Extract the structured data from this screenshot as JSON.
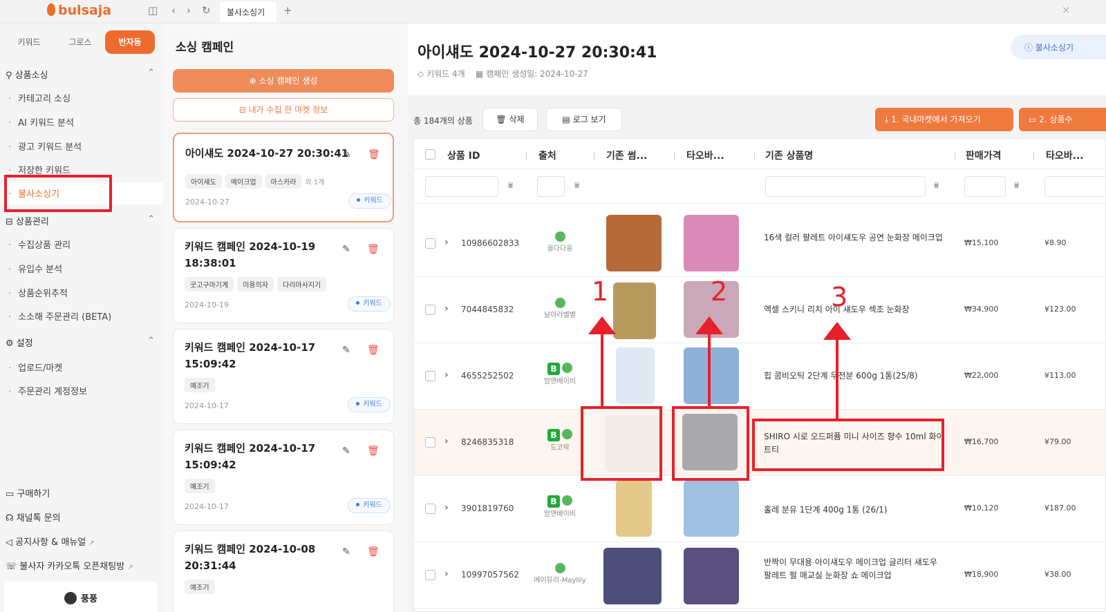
{
  "app": {
    "logo": "bulsaja",
    "tab_title": "불사소싱기"
  },
  "sidebar": {
    "segments": [
      "키워드",
      "그로스",
      "반자동"
    ],
    "active_segment": "반자동",
    "sections": [
      {
        "label": "상품소싱",
        "items": [
          "카테고리 소싱",
          "AI 키워드 분석",
          "광고 키워드 분석",
          "저장한 키워드",
          "불사소싱기"
        ]
      },
      {
        "label": "상품관리",
        "items": [
          "수집상품 관리",
          "유입수 분석",
          "상품순위추적",
          "소소해 주문관리 (BETA)"
        ]
      },
      {
        "label": "설정",
        "items": [
          "업로드/마켓",
          "주문관리 계정정보"
        ]
      }
    ],
    "selected_item": "불사소싱기",
    "bottom": [
      "구매하기",
      "채널톡 문의",
      "공지사항 & 매뉴얼",
      "불사자 카카오톡 오픈채팅방"
    ],
    "user_name": "풍풍"
  },
  "campaigns": {
    "title": "소싱 캠페인",
    "create_button": "소싱 캠페인 생성",
    "info_button": "내가 수집 한 마켓 정보",
    "cards": [
      {
        "title_line1": "아이섀도 2024-10-27 20:30:41",
        "title_line2": "",
        "chips": [
          "아이섀도",
          "메이크업",
          "마스카라"
        ],
        "more": "외 1개",
        "date": "2024-10-27",
        "badge": "키워드",
        "active": true
      },
      {
        "title_line1": "키워드 캠페인 2024-10-19",
        "title_line2": "18:38:01",
        "chips": [
          "굿고구마기계",
          "미용의자",
          "다리마사지기"
        ],
        "more": "",
        "date": "2024-10-19",
        "badge": "키워드"
      },
      {
        "title_line1": "키워드 캠페인 2024-10-17",
        "title_line2": "15:09:42",
        "chips": [
          "예조기"
        ],
        "more": "",
        "date": "2024-10-17",
        "badge": "키워드"
      },
      {
        "title_line1": "키워드 캠페인 2024-10-17",
        "title_line2": "15:09:42",
        "chips": [
          "예조기"
        ],
        "more": "",
        "date": "2024-10-17",
        "badge": "키워드"
      },
      {
        "title_line1": "키워드 캠페인 2024-10-08",
        "title_line2": "20:31:44",
        "chips": [
          "예조기"
        ],
        "more": "",
        "date": "",
        "badge": ""
      }
    ]
  },
  "main": {
    "title": "아이섀도 2024-10-27 20:30:41",
    "meta_keywords": "키워드 4개",
    "meta_created": "캠페인 생성일: 2024-10-27",
    "help_button": "불사소싱기",
    "count": "총 184개의 상품",
    "delete_button": "삭제",
    "log_button": "로그 보기",
    "import_button": "1. 국내마켓에서 가져오기",
    "step2_button": "2. 상품수",
    "columns": [
      "상품 ID",
      "출처",
      "기존 썸...",
      "타오바...",
      "기존 상품명",
      "판매가격",
      "타오바..."
    ],
    "rows": [
      {
        "id": "10986602833",
        "source": "올다다옹",
        "badge_b": "",
        "name": "16색 컬러 팔레트 아이섀도우 공연 눈화장 메이크업",
        "price": "₩15,100",
        "yen": "¥8.90",
        "thumb_a": "#b56a3a",
        "thumb_b": "#d98ab6"
      },
      {
        "id": "7044845832",
        "source": "날아라별별",
        "badge_b": "",
        "name": "엑셀 스키니 리치 아이 섀도우 섹조 눈화장",
        "price": "₩34,900",
        "yen": "¥123.00",
        "thumb_a": "#b89a5e",
        "thumb_b": "#caa8b8"
      },
      {
        "id": "4655252502",
        "source": "맘앤베이비",
        "badge_b": "B",
        "name": "힙 콤비오틱 2단계 무전분 600g 1통(25/8)",
        "price": "₩22,000",
        "yen": "¥113.00",
        "thumb_a": "#dfe9f3",
        "thumb_b": "#8fb1d8"
      },
      {
        "id": "8246835318",
        "source": "도코락",
        "badge_b": "B",
        "name": "SHIRO 시로 오드퍼퓸 미니 사이즈 향수 10ml 화이트티",
        "price": "₩16,700",
        "yen": "¥79.00",
        "thumb_a": "#f1ece6",
        "thumb_b": "#a9a9ad"
      },
      {
        "id": "3901819760",
        "source": "맘앤베이비",
        "badge_b": "B",
        "name": "홀레 분유 1단계 400g 1통 (26/1)",
        "price": "₩10,120",
        "yen": "¥187.00",
        "thumb_a": "#e3c98a",
        "thumb_b": "#9fc0e0"
      },
      {
        "id": "10997057562",
        "source": "메이뮤리-Mayllly",
        "badge_b": "",
        "name": "반짝이 무대용 아이섀도우 메이크업 글리터 섀도우 팔레트 펄 매교실 눈화장 쇼 메이크업",
        "price": "₩18,900",
        "yen": "¥38.00",
        "thumb_a": "#4d4f7a",
        "thumb_b": "#5a4f7e"
      }
    ]
  },
  "annotations": {
    "labels": [
      "1",
      "2",
      "3"
    ],
    "color": "#e8202b"
  }
}
